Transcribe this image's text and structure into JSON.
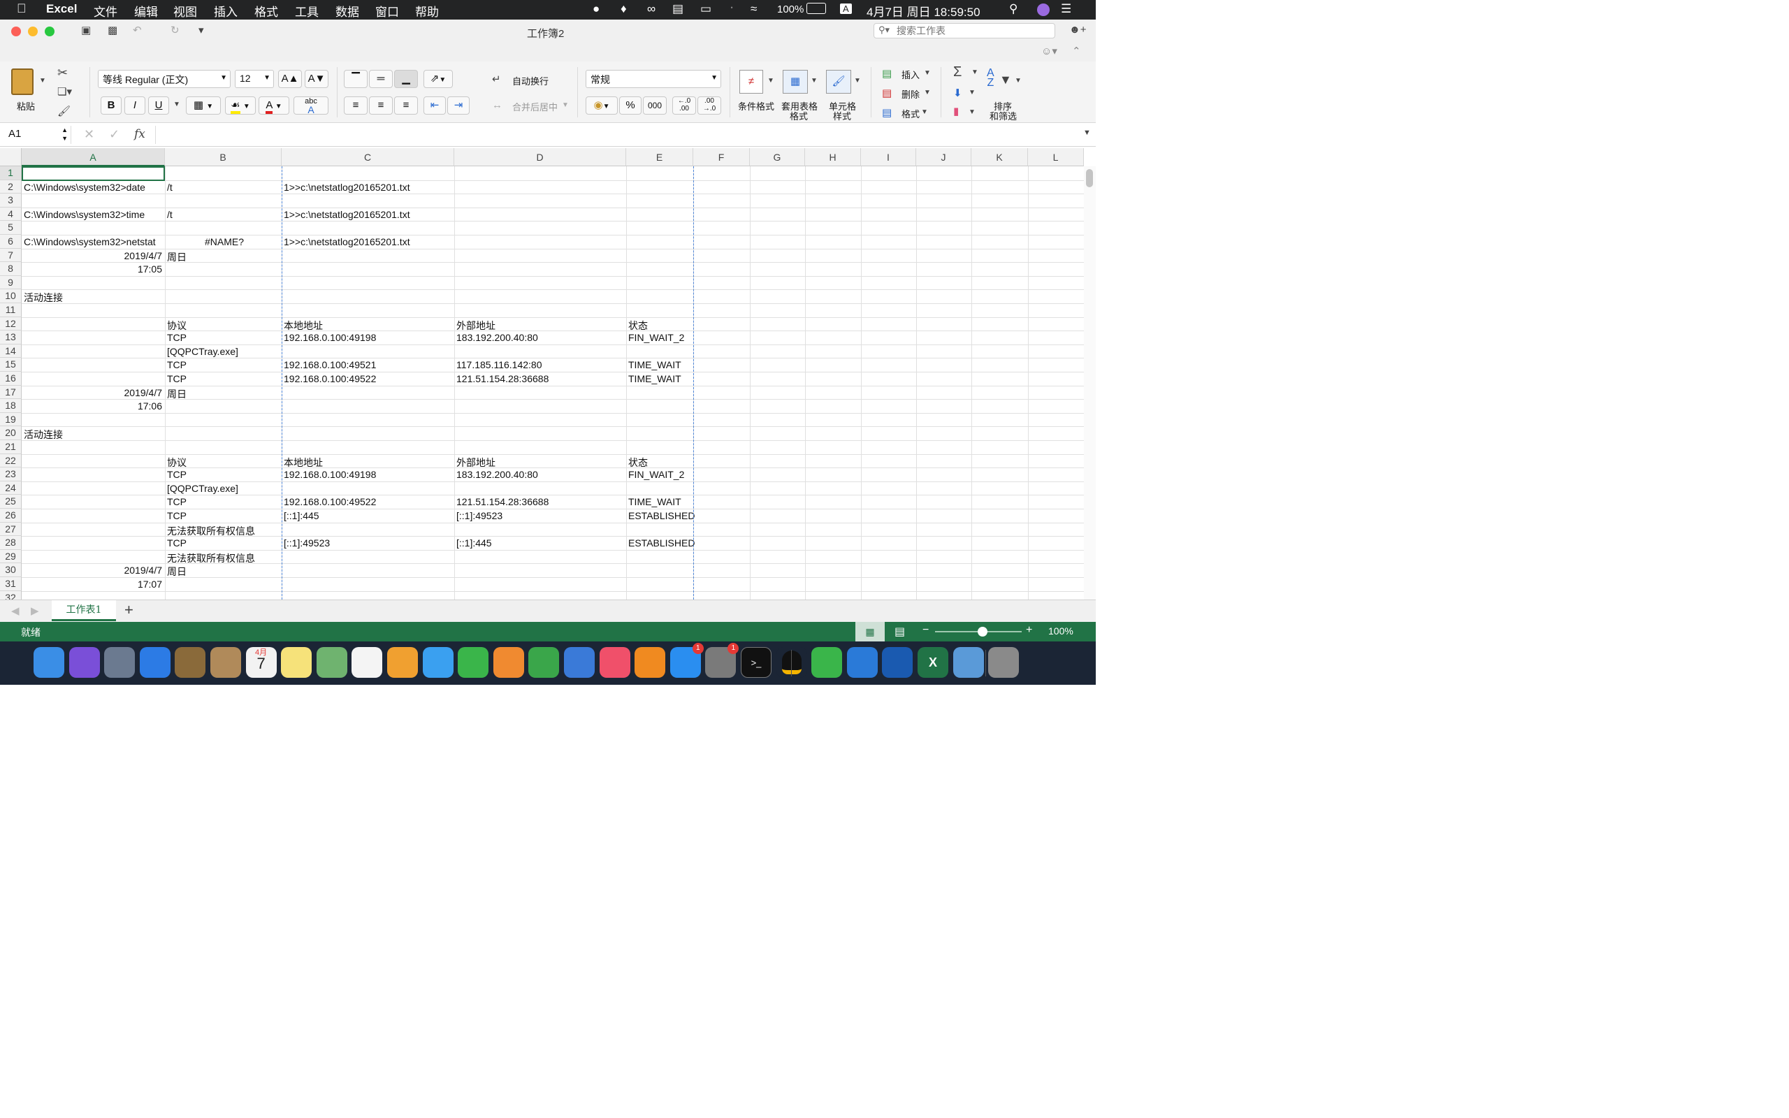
{
  "menubar": {
    "app": "Excel",
    "items": [
      "文件",
      "编辑",
      "视图",
      "插入",
      "格式",
      "工具",
      "数据",
      "窗口",
      "帮助"
    ],
    "battery": "100%",
    "input_method": "A",
    "datetime": "4月7日 周日 18:59:50"
  },
  "window": {
    "title": "工作簿2",
    "search_placeholder": "搜索工作表"
  },
  "ribbon": {
    "paste": "粘贴",
    "font_name": "等线 Regular (正文)",
    "font_size": "12",
    "bold": "B",
    "italic": "I",
    "underline": "U",
    "wrap_text": "自动换行",
    "merge_center": "合并后居中",
    "number_format": "常规",
    "percent": "%",
    "thousands": "000",
    "cond_format": "条件格式",
    "table_format_1": "套用表格",
    "table_format_2": "格式",
    "cell_style_1": "单元格",
    "cell_style_2": "样式",
    "insert": "插入",
    "delete": "删除",
    "format": "格式",
    "sort_1": "排序",
    "sort_2": "和筛选",
    "colors": {
      "highlight": "#ffeb00",
      "font": "#e02020",
      "excel_green": "#217346"
    }
  },
  "formula_bar": {
    "name_box": "A1",
    "fx": "fx",
    "value": ""
  },
  "sheet": {
    "columns": [
      "A",
      "B",
      "C",
      "D",
      "E",
      "F",
      "G",
      "H",
      "I",
      "J",
      "K",
      "L"
    ],
    "rows": [
      {
        "n": "1",
        "A": "",
        "B": "",
        "C": "",
        "D": "",
        "E": ""
      },
      {
        "n": "2",
        "A": "C:\\Windows\\system32>date",
        "B": "/t",
        "C": "1>>c:\\netstatlog20165201.txt",
        "D": "",
        "E": ""
      },
      {
        "n": "3",
        "A": "",
        "B": "",
        "C": "",
        "D": "",
        "E": ""
      },
      {
        "n": "4",
        "A": "C:\\Windows\\system32>time",
        "B": "/t",
        "C": "1>>c:\\netstatlog20165201.txt",
        "D": "",
        "E": ""
      },
      {
        "n": "5",
        "A": "",
        "B": "",
        "C": "",
        "D": "",
        "E": ""
      },
      {
        "n": "6",
        "A": "C:\\Windows\\system32>netstat",
        "B": "#NAME?",
        "C": "1>>c:\\netstatlog20165201.txt",
        "D": "",
        "E": ""
      },
      {
        "n": "7",
        "A": "2019/4/7",
        "B": "周日",
        "C": "",
        "D": "",
        "E": ""
      },
      {
        "n": "8",
        "A": "17:05",
        "B": "",
        "C": "",
        "D": "",
        "E": ""
      },
      {
        "n": "9",
        "A": "",
        "B": "",
        "C": "",
        "D": "",
        "E": ""
      },
      {
        "n": "10",
        "A": "活动连接",
        "B": "",
        "C": "",
        "D": "",
        "E": ""
      },
      {
        "n": "11",
        "A": "",
        "B": "",
        "C": "",
        "D": "",
        "E": ""
      },
      {
        "n": "12",
        "A": "",
        "B": "协议",
        "C": "本地地址",
        "D": "外部地址",
        "E": "状态"
      },
      {
        "n": "13",
        "A": "",
        "B": "TCP",
        "C": "192.168.0.100:49198",
        "D": "183.192.200.40:80",
        "E": "FIN_WAIT_2"
      },
      {
        "n": "14",
        "A": "",
        "B": "[QQPCTray.exe]",
        "C": "",
        "D": "",
        "E": ""
      },
      {
        "n": "15",
        "A": "",
        "B": "TCP",
        "C": "192.168.0.100:49521",
        "D": "117.185.116.142:80",
        "E": "TIME_WAIT"
      },
      {
        "n": "16",
        "A": "",
        "B": "TCP",
        "C": "192.168.0.100:49522",
        "D": "121.51.154.28:36688",
        "E": "TIME_WAIT"
      },
      {
        "n": "17",
        "A": "2019/4/7",
        "B": "周日",
        "C": "",
        "D": "",
        "E": ""
      },
      {
        "n": "18",
        "A": "17:06",
        "B": "",
        "C": "",
        "D": "",
        "E": ""
      },
      {
        "n": "19",
        "A": "",
        "B": "",
        "C": "",
        "D": "",
        "E": ""
      },
      {
        "n": "20",
        "A": "活动连接",
        "B": "",
        "C": "",
        "D": "",
        "E": ""
      },
      {
        "n": "21",
        "A": "",
        "B": "",
        "C": "",
        "D": "",
        "E": ""
      },
      {
        "n": "22",
        "A": "",
        "B": "协议",
        "C": "本地地址",
        "D": "外部地址",
        "E": "状态"
      },
      {
        "n": "23",
        "A": "",
        "B": "TCP",
        "C": "192.168.0.100:49198",
        "D": "183.192.200.40:80",
        "E": "FIN_WAIT_2"
      },
      {
        "n": "24",
        "A": "",
        "B": "[QQPCTray.exe]",
        "C": "",
        "D": "",
        "E": ""
      },
      {
        "n": "25",
        "A": "",
        "B": "TCP",
        "C": "192.168.0.100:49522",
        "D": "121.51.154.28:36688",
        "E": "TIME_WAIT"
      },
      {
        "n": "26",
        "A": "",
        "B": "TCP",
        "C": "[::1]:445",
        "D": "[::1]:49523",
        "E": "ESTABLISHED"
      },
      {
        "n": "27",
        "A": "",
        "B": "无法获取所有权信息",
        "C": "",
        "D": "",
        "E": ""
      },
      {
        "n": "28",
        "A": "",
        "B": "TCP",
        "C": "[::1]:49523",
        "D": "[::1]:445",
        "E": "ESTABLISHED"
      },
      {
        "n": "29",
        "A": "",
        "B": "无法获取所有权信息",
        "C": "",
        "D": "",
        "E": ""
      },
      {
        "n": "30",
        "A": "2019/4/7",
        "B": "周日",
        "C": "",
        "D": "",
        "E": ""
      },
      {
        "n": "31",
        "A": "17:07",
        "B": "",
        "C": "",
        "D": "",
        "E": ""
      },
      {
        "n": "32",
        "A": "",
        "B": "",
        "C": "",
        "D": "",
        "E": ""
      }
    ],
    "right_aligned": [
      "2019/4/7",
      "17:05",
      "17:06",
      "17:07"
    ],
    "center_aligned": [
      "#NAME?"
    ]
  },
  "tabs": {
    "sheet1": "工作表1",
    "add": "+"
  },
  "status": {
    "ready": "就绪",
    "zoom": "100%",
    "zoom_fraction": 0.55
  },
  "dock": {
    "apps": [
      {
        "name": "finder-icon",
        "color": "#3a8ee6"
      },
      {
        "name": "siri-icon",
        "color": "#7a4fd8"
      },
      {
        "name": "launchpad-icon",
        "color": "#6b7a90"
      },
      {
        "name": "safari-icon",
        "color": "#2c7be5"
      },
      {
        "name": "preview-icon",
        "color": "#8a6a3a"
      },
      {
        "name": "contacts-icon",
        "color": "#b08a5a"
      },
      {
        "name": "calendar-icon",
        "color": "#f2f2f2"
      },
      {
        "name": "notes-icon",
        "color": "#f6e27a"
      },
      {
        "name": "maps-icon",
        "color": "#6fb36f"
      },
      {
        "name": "reminders-icon",
        "color": "#f4f4f4"
      },
      {
        "name": "photos-icon",
        "color": "#f0a030"
      },
      {
        "name": "messages-icon",
        "color": "#3aa0f0"
      },
      {
        "name": "facetime-icon",
        "color": "#3ab54a"
      },
      {
        "name": "pages-icon",
        "color": "#f08a30"
      },
      {
        "name": "numbers-icon",
        "color": "#3aa64a"
      },
      {
        "name": "keynote-icon",
        "color": "#3a7ad8"
      },
      {
        "name": "music-icon",
        "color": "#f0506a"
      },
      {
        "name": "books-icon",
        "color": "#f08a20"
      },
      {
        "name": "appstore-icon",
        "color": "#2a8ef0",
        "badge": "1"
      },
      {
        "name": "system-prefs-icon",
        "color": "#7a7a7a",
        "badge": "1"
      },
      {
        "name": "terminal-icon",
        "color": "#111111"
      },
      {
        "name": "qq-icon",
        "color": "#1b2535"
      },
      {
        "name": "wechat-icon",
        "color": "#3ab54a"
      },
      {
        "name": "markdown-icon",
        "color": "#2a7ad8"
      },
      {
        "name": "virtualbox-icon",
        "color": "#1a5ab0"
      },
      {
        "name": "excel-icon",
        "color": "#217346"
      },
      {
        "name": "downloads-icon",
        "color": "#5a9ad8"
      },
      {
        "name": "trash-icon",
        "color": "#8a8a8a"
      }
    ],
    "calendar_month": "4月",
    "calendar_day": "7",
    "terminal_glyph": ">_",
    "excel_glyph": "X"
  }
}
